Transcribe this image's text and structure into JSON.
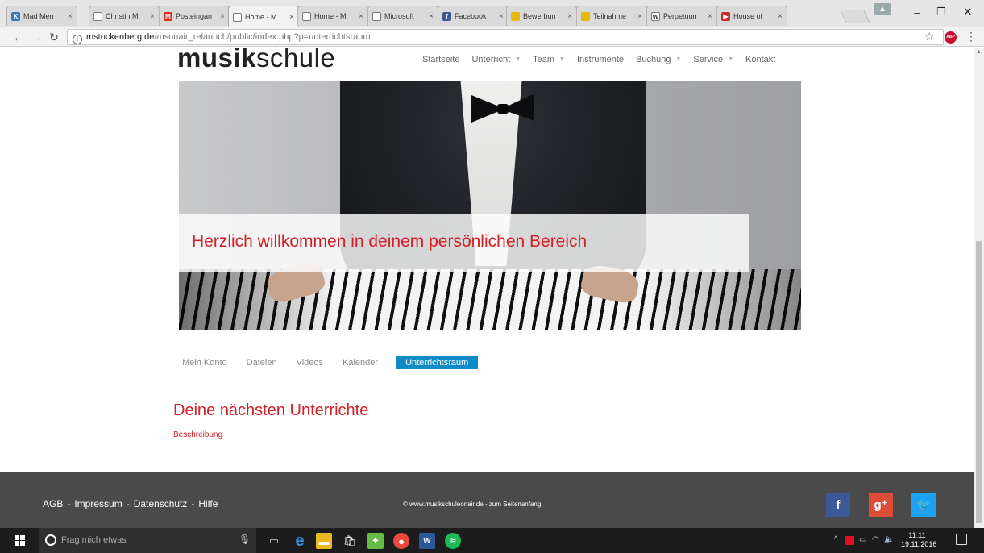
{
  "browser": {
    "tabs": [
      {
        "title": "Mad Men",
        "favicon_color": "#2f7bbf",
        "favicon_glyph": "K"
      },
      {
        "title": "Christin M",
        "favicon_color": "#ffffff",
        "favicon_glyph": ""
      },
      {
        "title": "Posteingan",
        "favicon_color": "#d93025",
        "favicon_glyph": "M"
      },
      {
        "title": "Home - M",
        "favicon_color": "#ffffff",
        "favicon_glyph": "",
        "active": true
      },
      {
        "title": "Home - M",
        "favicon_color": "#ffffff",
        "favicon_glyph": ""
      },
      {
        "title": "Microsoft",
        "favicon_color": "#ffffff",
        "favicon_glyph": ""
      },
      {
        "title": "Facebook",
        "favicon_color": "#3b5998",
        "favicon_glyph": "f"
      },
      {
        "title": "Bewerbun",
        "favicon_color": "#e6b800",
        "favicon_glyph": ""
      },
      {
        "title": "Teilnahme",
        "favicon_color": "#e6b800",
        "favicon_glyph": ""
      },
      {
        "title": "Perpetuun",
        "favicon_color": "#ffffff",
        "favicon_glyph": "W"
      },
      {
        "title": "House of",
        "favicon_color": "#c4302b",
        "favicon_glyph": "▶"
      }
    ],
    "url_domain": "mstockenberg.de",
    "url_path": "/msonair_relaunch/public/index.php?p=unterrichtsraum",
    "extension_label": "ABP"
  },
  "site": {
    "logo_bold": "musik",
    "logo_light": "schule",
    "nav": [
      "Startseite",
      "Unterricht",
      "Team",
      "Instrumente",
      "Buchung",
      "Service",
      "Kontakt"
    ],
    "nav_dropdown_flags": [
      false,
      true,
      true,
      false,
      true,
      true,
      false
    ],
    "hero_welcome": "Herzlich willkommen in deinem persönlichen Bereich",
    "subnav": [
      "Mein Konto",
      "Dateien",
      "Videos",
      "Kalender"
    ],
    "subnav_active": "Unterrichtsraum",
    "section_title": "Deine nächsten Unterrichte",
    "section_link": "Beschreibung",
    "footer_links": [
      "AGB",
      "Impressum",
      "Datenschutz",
      "Hilfe"
    ],
    "footer_sep": "-",
    "footer_copy": "© www.musikschuleonair.de  -  zum Seitenanfang",
    "social": [
      {
        "name": "facebook",
        "glyph": "f",
        "color": "#3b5998"
      },
      {
        "name": "google-plus",
        "glyph": "g⁺",
        "color": "#dd4b39"
      },
      {
        "name": "twitter",
        "glyph": "🐦",
        "color": "#1da1f2"
      }
    ],
    "colors": {
      "accent_red": "#d41f26",
      "accent_blue": "#0f8cc7",
      "footer_bg": "#4a4a4a"
    }
  },
  "taskbar": {
    "search_placeholder": "Frag mich etwas",
    "time": "11:11",
    "date": "19.11.2016"
  }
}
